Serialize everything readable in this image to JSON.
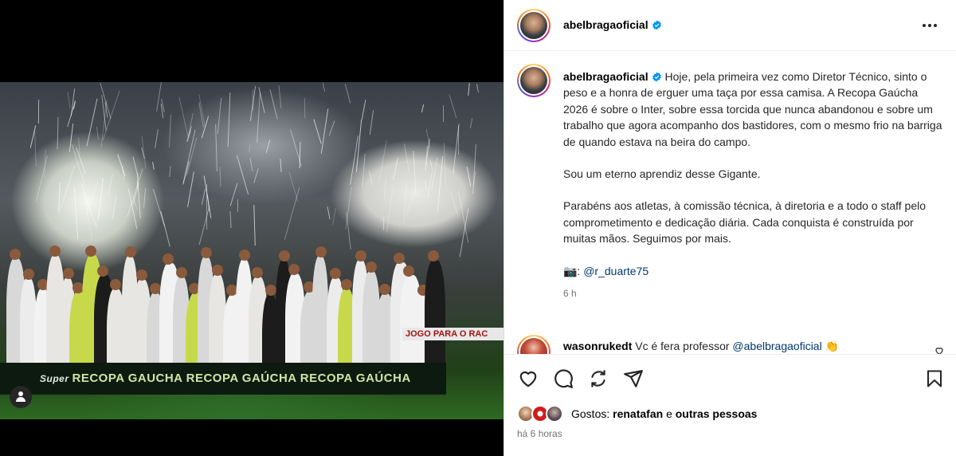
{
  "media": {
    "banner_text": "JOGO PARA O RAC",
    "stage_brand_prefix": "Super",
    "stage_brand_text": "RECOPA GAUCHA   RECOPA GAÚCHA   RECOPA GAÚCHA"
  },
  "header": {
    "username": "abelbragaoficial",
    "verified": true
  },
  "caption": {
    "username": "abelbragaoficial",
    "paragraph1": "Hoje, pela primeira vez como Diretor Técnico, sinto o peso e a honra de erguer uma taça por essa camisa. A Recopa Gaúcha 2026 é sobre o Inter, sobre essa torcida que nunca abandonou e sobre um trabalho que agora acompanho dos bastidores, com o mesmo frio na barriga de quando estava na beira do campo.",
    "paragraph2": "Sou um eterno aprendiz desse Gigante.",
    "paragraph3": "Parabéns aos atletas, à comissão técnica, à diretoria e a todo o staff pelo comprometimento e dedicação diária. Cada conquista é construída por muitas mãos. Seguimos por mais.",
    "credit_emoji": "📷:",
    "credit_mention": "@r_duarte75",
    "time": "6 h"
  },
  "comment": {
    "username": "wasonrukedt",
    "text": "Vc é fera professor",
    "mention": "@abelbragaoficial",
    "emoji": "👏"
  },
  "likes": {
    "label": "Gostos:",
    "user": "renatafan",
    "connector": "e",
    "others": "outras pessoas"
  },
  "post_time": "há 6 horas",
  "colors": {
    "verified_badge": "#0095f6",
    "mention": "#00376b",
    "secondary_text": "#737373"
  },
  "icons": [
    "more-options-icon",
    "verified-icon",
    "heart-icon",
    "comment-icon",
    "repost-icon",
    "share-icon",
    "bookmark-icon",
    "tag-user-icon"
  ]
}
